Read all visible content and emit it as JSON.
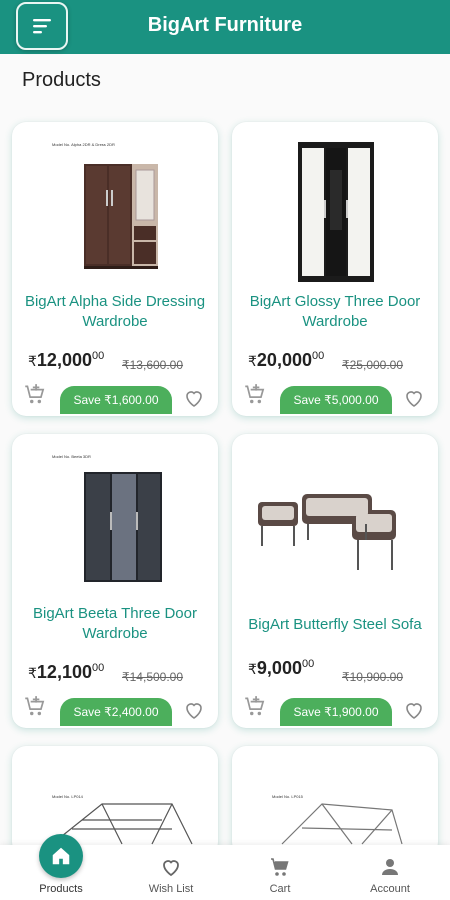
{
  "app": {
    "title": "BigArt Furniture"
  },
  "page": {
    "title": "Products"
  },
  "products": [
    {
      "name": "BigArt Alpha Side Dressing Wardrobe",
      "price_main": "12,000",
      "price_decimal": "00",
      "currency": "₹",
      "mrp": "₹13,600.00",
      "save": "Save ₹1,600.00",
      "model_label": "Model No. Alpha 2DR & Dress 2DR"
    },
    {
      "name": "BigArt Glossy Three Door Wardrobe",
      "price_main": "20,000",
      "price_decimal": "00",
      "currency": "₹",
      "mrp": "₹25,000.00",
      "save": "Save ₹5,000.00"
    },
    {
      "name": "BigArt Beeta Three Door Wardrobe",
      "price_main": "12,100",
      "price_decimal": "00",
      "currency": "₹",
      "mrp": "₹14,500.00",
      "save": "Save ₹2,400.00",
      "model_label": "Model No. Beeta 3DR"
    },
    {
      "name": "BigArt Butterfly Steel Sofa",
      "price_main": "9,000",
      "price_decimal": "00",
      "currency": "₹",
      "mrp": "₹10,900.00",
      "save": "Save ₹1,900.00"
    },
    {
      "model_label": "Model No. LP014"
    },
    {
      "model_label": "Model No. LP015"
    }
  ],
  "nav": {
    "items": [
      {
        "label": "Products",
        "icon": "home-icon",
        "active": true
      },
      {
        "label": "Wish List",
        "icon": "heart-icon"
      },
      {
        "label": "Cart",
        "icon": "cart-icon"
      },
      {
        "label": "Account",
        "icon": "person-icon"
      }
    ]
  },
  "colors": {
    "primary": "#1a9281",
    "save_badge": "#4caf5c",
    "background": "#fafafa"
  }
}
